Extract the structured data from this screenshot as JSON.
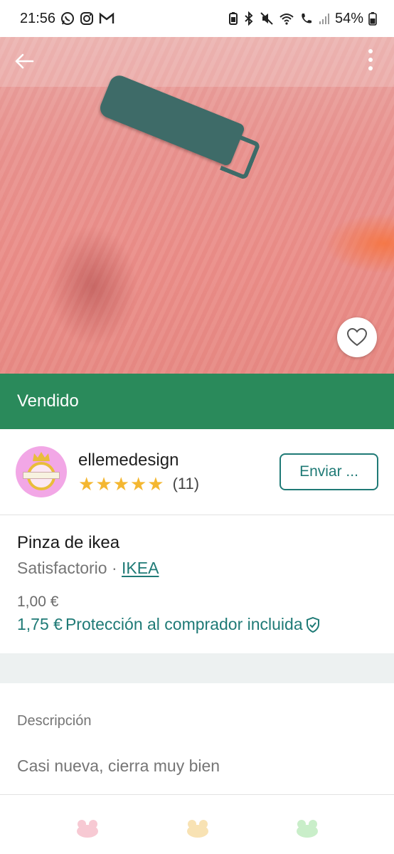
{
  "status_bar": {
    "time": "21:56",
    "battery": "54%",
    "left_icons": [
      "whatsapp-icon",
      "instagram-icon",
      "gmail-icon"
    ],
    "right_icons": [
      "battery-saver-icon",
      "bluetooth-icon",
      "mute-icon",
      "wifi-icon",
      "wifi-call-icon",
      "signal-icon",
      "battery-icon"
    ]
  },
  "photo": {
    "icons": {
      "back": "arrow-left-icon",
      "more": "more-vertical-icon",
      "favorite": "heart-icon"
    }
  },
  "sold_banner": {
    "label": "Vendido"
  },
  "seller": {
    "name": "ellemedesign",
    "rating_stars": 5,
    "review_count": "(11)",
    "send_button": "Enviar ..."
  },
  "item": {
    "title": "Pinza de ikea",
    "condition": "Satisfactorio",
    "separator": " · ",
    "brand": "IKEA",
    "price": "1,00 €",
    "price_with_protection": "1,75 €",
    "protection_label": "Protección al comprador incluida"
  },
  "description": {
    "label": "Descripción",
    "text": "Casi nueva, cierra muy bien"
  },
  "colors": {
    "brand_teal": "#1f7a76",
    "sold_green": "#2a8a5b",
    "star_yellow": "#f4b731"
  }
}
